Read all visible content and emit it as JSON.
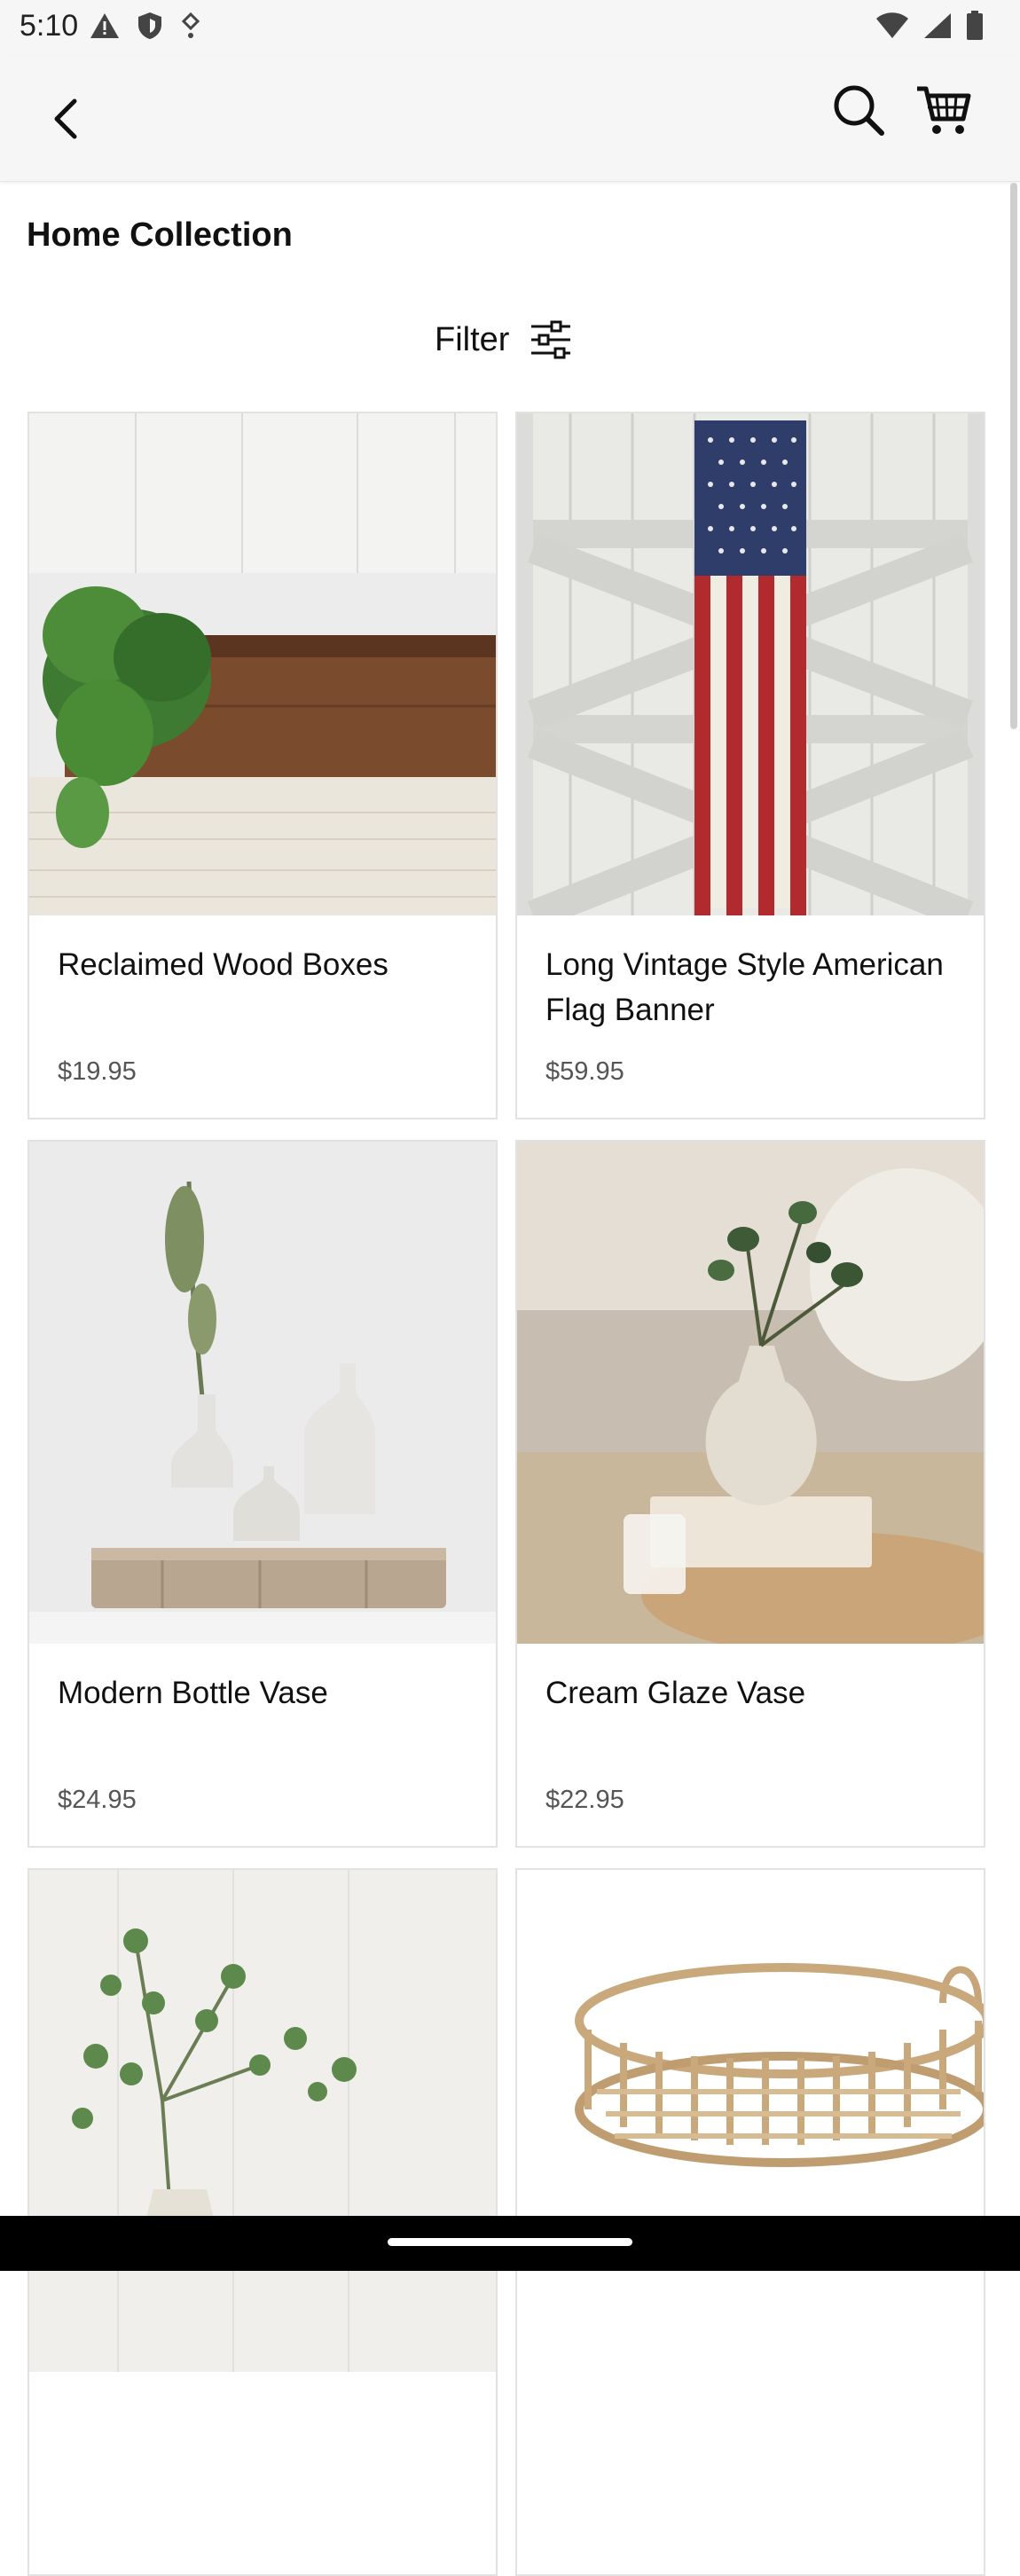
{
  "status_bar": {
    "time": "5:10"
  },
  "header": {
    "back_icon": "chevron-left-icon",
    "search_icon": "search-icon",
    "cart_icon": "cart-icon"
  },
  "page": {
    "title": "Home Collection"
  },
  "filter": {
    "label": "Filter",
    "icon": "sliders-icon"
  },
  "products": [
    {
      "name": "Reclaimed Wood Boxes",
      "price": "$19.95"
    },
    {
      "name": "Long Vintage Style American Flag Banner",
      "price": "$59.95"
    },
    {
      "name": "Modern Bottle Vase",
      "price": "$24.95"
    },
    {
      "name": "Cream Glaze Vase",
      "price": "$22.95"
    },
    {
      "name": "",
      "price": ""
    },
    {
      "name": "",
      "price": ""
    }
  ]
}
